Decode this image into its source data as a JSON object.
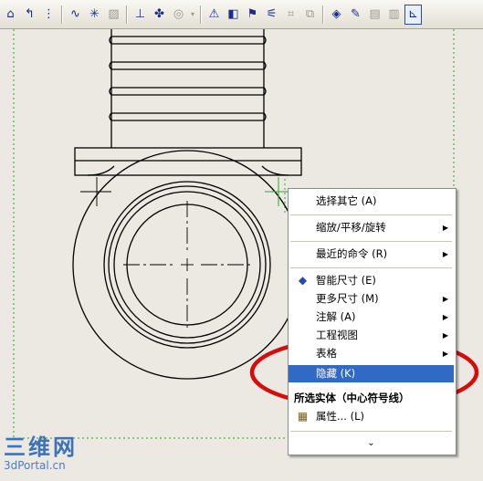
{
  "toolbar": {
    "icons": [
      "arc-dim-icon",
      "arrow-up-icon",
      "dashed-line-icon",
      "sep",
      "spline-icon",
      "star-point-icon",
      "hatch-icon",
      "sep",
      "datum-icon",
      "weld-icon",
      "surface-finish-icon",
      "sep",
      "triangle-note-icon",
      "block-icon",
      "flag-icon",
      "balloon-icon",
      "grid-icon",
      "sep",
      "cube-icon",
      "wand-icon",
      "table-icon",
      "view-icon"
    ]
  },
  "context_menu": {
    "items": [
      {
        "label": "选择其它 (A)",
        "type": "item"
      },
      {
        "type": "separator"
      },
      {
        "label": "缩放/平移/旋转",
        "type": "submenu"
      },
      {
        "type": "separator"
      },
      {
        "label": "最近的命令 (R)",
        "type": "submenu"
      },
      {
        "type": "separator"
      },
      {
        "label": "智能尺寸 (E)",
        "type": "item",
        "icon": "smart-dimension-icon"
      },
      {
        "label": "更多尺寸 (M)",
        "type": "submenu"
      },
      {
        "label": "注解 (A)",
        "type": "submenu"
      },
      {
        "label": "工程视图",
        "type": "submenu"
      },
      {
        "label": "表格",
        "type": "submenu"
      },
      {
        "label": "隐藏 (K)",
        "type": "item",
        "selected": true
      },
      {
        "label": "所选实体（中心符号线）",
        "type": "header"
      },
      {
        "label": "属性... (L)",
        "type": "item",
        "icon": "properties-icon"
      },
      {
        "type": "separator"
      },
      {
        "label": "⌄",
        "type": "more"
      }
    ]
  },
  "watermark": {
    "logo": "三维网",
    "site": "3dPortal.cn"
  },
  "colors": {
    "annotation_ellipse": "#d40d0d",
    "selection": "#316ac5",
    "sheet_border": "#2ea82e"
  }
}
